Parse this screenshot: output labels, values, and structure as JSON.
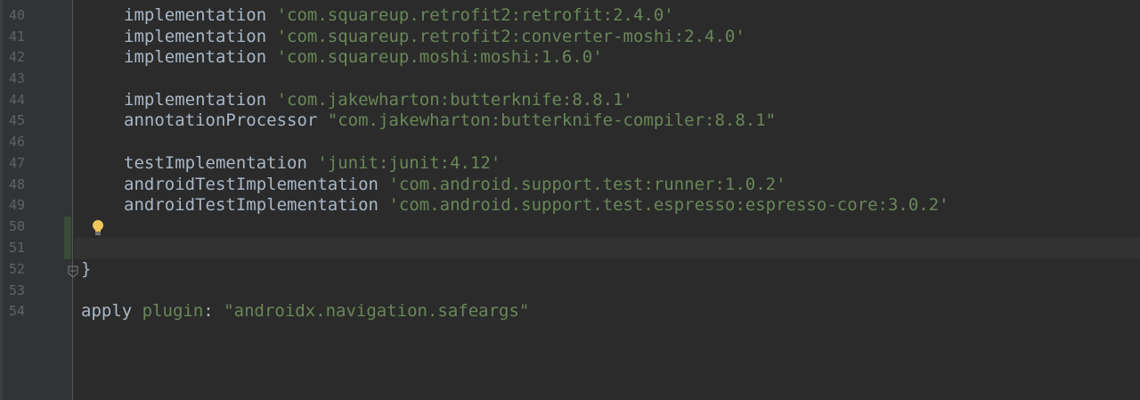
{
  "editor": {
    "line_numbers": [
      "40",
      "41",
      "42",
      "43",
      "44",
      "45",
      "46",
      "47",
      "48",
      "49",
      "50",
      "51",
      "52",
      "53",
      "54"
    ],
    "lines": {
      "l40": {
        "kw": "implementation",
        "str": "'com.squareup.retrofit2:retrofit:2.4.0'"
      },
      "l41": {
        "kw": "implementation",
        "str": "'com.squareup.retrofit2:converter-moshi:2.4.0'"
      },
      "l42": {
        "kw": "implementation",
        "str": "'com.squareup.moshi:moshi:1.6.0'"
      },
      "l44": {
        "kw": "implementation",
        "str": "'com.jakewharton:butterknife:8.8.1'"
      },
      "l45": {
        "kw": "annotationProcessor",
        "str": "\"com.jakewharton:butterknife-compiler:8.8.1\""
      },
      "l47": {
        "kw": "testImplementation",
        "str": "'junit:junit:4.12'"
      },
      "l48": {
        "kw": "androidTestImplementation",
        "str": "'com.android.support.test:runner:1.0.2'"
      },
      "l49": {
        "kw": "androidTestImplementation",
        "str": "'com.android.support.test.espresso:espresso-core:3.0.2'"
      },
      "l52": {
        "text": "}"
      },
      "l54": {
        "kw": "apply",
        "plugin": "plugin",
        "colon": ":",
        "str": "\"androidx.navigation.safeargs\""
      }
    }
  },
  "colors": {
    "background": "#2b2b2b",
    "gutter": "#313335",
    "line_number": "#606366",
    "string": "#6a8759",
    "text": "#a9b7c6",
    "change_marker": "#384c38",
    "current_line": "#323232"
  },
  "icons": {
    "intention": "lightbulb-icon",
    "fold": "fold-end-icon"
  }
}
